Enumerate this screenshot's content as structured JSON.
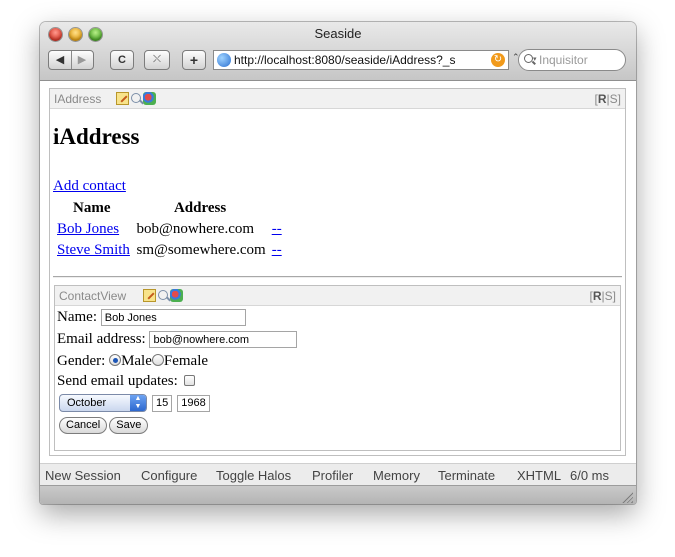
{
  "window": {
    "title": "Seaside"
  },
  "toolbar": {
    "back_glyph": "◀",
    "forward_glyph": "▶",
    "reload_glyph": "C",
    "snapback_glyph": "⤬",
    "add_glyph": "+",
    "url": "http://localhost:8080/seaside/iAddress?_s",
    "feed_glyph": "↻",
    "url_menu_glyph": "⌃",
    "search_placeholder": "Inquisitor"
  },
  "outer_halo": {
    "name": "IAddress",
    "r_label": "R",
    "sep": "|",
    "s_label": "S",
    "open_bracket": "[",
    "close_bracket": "]"
  },
  "app": {
    "title": "iAddress",
    "add_contact": "Add contact",
    "columns": {
      "name": "Name",
      "address": "Address"
    },
    "contacts": [
      {
        "name": "Bob Jones",
        "address": "bob@nowhere.com",
        "remove": "--"
      },
      {
        "name": "Steve Smith",
        "address": "sm@somewhere.com",
        "remove": "--"
      }
    ]
  },
  "inner_halo": {
    "name": "ContactView",
    "r_label": "R",
    "sep": "|",
    "s_label": "S",
    "open_bracket": "[",
    "close_bracket": "]"
  },
  "form": {
    "name_label": "Name:",
    "name_value": "Bob Jones",
    "email_label": "Email address:",
    "email_value": "bob@nowhere.com",
    "gender_label": "Gender:",
    "male_label": "Male",
    "female_label": "Female",
    "updates_label": "Send email updates:",
    "month": "October",
    "day": "15",
    "year": "1968",
    "cancel": "Cancel",
    "save": "Save"
  },
  "dev_toolbar": {
    "new_session": "New Session",
    "configure": "Configure",
    "toggle_halos": "Toggle Halos",
    "profiler": "Profiler",
    "memory": "Memory",
    "terminate": "Terminate",
    "xhtml": "XHTML",
    "timing": "6/0 ms"
  }
}
